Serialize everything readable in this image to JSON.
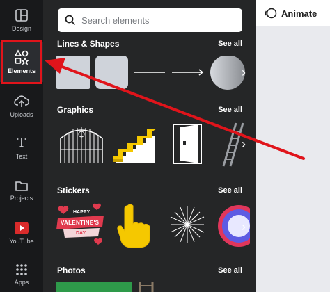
{
  "sidebar": {
    "items": [
      {
        "label": "Design",
        "icon": "layout-icon"
      },
      {
        "label": "Elements",
        "icon": "shapes-icon",
        "active": true
      },
      {
        "label": "Uploads",
        "icon": "cloud-upload-icon"
      },
      {
        "label": "Text",
        "icon": "text-t-icon"
      },
      {
        "label": "Projects",
        "icon": "folder-icon"
      },
      {
        "label": "YouTube",
        "icon": "youtube-icon"
      },
      {
        "label": "Apps",
        "icon": "grid-dots-icon"
      }
    ]
  },
  "search": {
    "placeholder": "Search elements"
  },
  "sections": [
    {
      "title": "Lines & Shapes",
      "see_all": "See all"
    },
    {
      "title": "Graphics",
      "see_all": "See all"
    },
    {
      "title": "Stickers",
      "see_all": "See all"
    },
    {
      "title": "Photos",
      "see_all": "See all"
    }
  ],
  "stickers": {
    "valentine_line1": "HAPPY",
    "valentine_line2": "VALENTINE'S",
    "valentine_line3": "DAY"
  },
  "topbar": {
    "animate_label": "Animate"
  },
  "colors": {
    "rail_bg": "#18191b",
    "panel_bg": "#252627",
    "annotation_red": "#e0141b",
    "accent_yellow": "#f5c800"
  }
}
